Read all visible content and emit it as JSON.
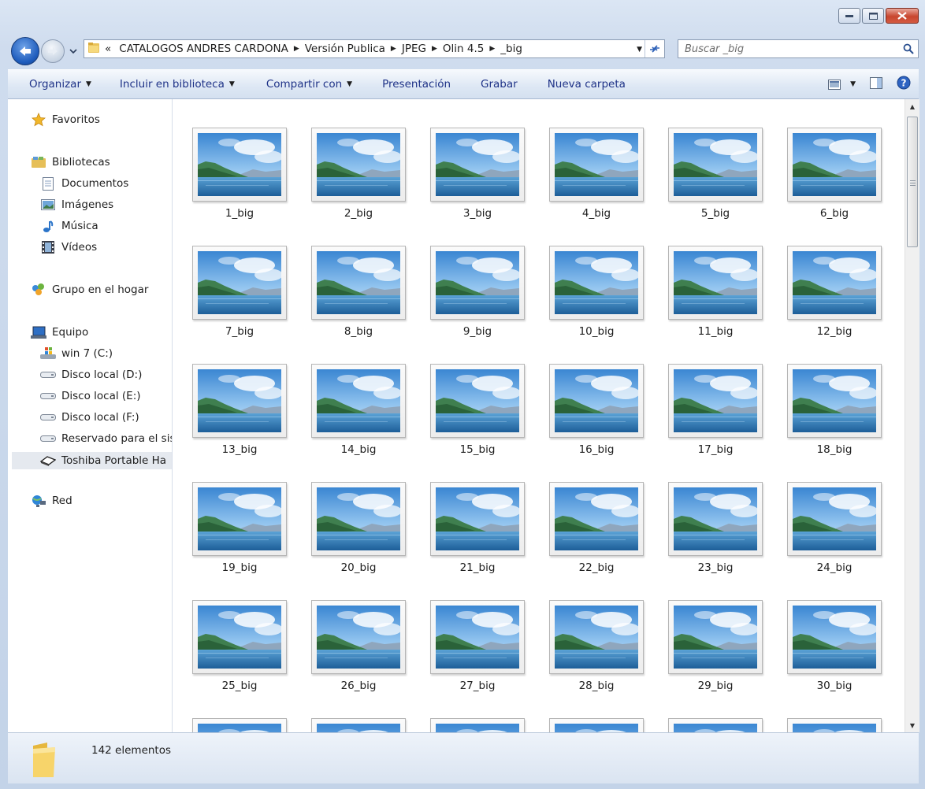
{
  "window": {
    "caption_buttons": [
      "minimize",
      "maximize",
      "close"
    ]
  },
  "address_bar": {
    "overflow": "«",
    "crumbs": [
      "CATALOGOS ANDRES CARDONA",
      "Versión Publica",
      "JPEG",
      "Olin 4.5",
      "_big"
    ]
  },
  "search": {
    "placeholder": "Buscar _big"
  },
  "toolbar": {
    "organize": "Organizar",
    "include_library": "Incluir en biblioteca",
    "share_with": "Compartir con",
    "slideshow": "Presentación",
    "burn": "Grabar",
    "new_folder": "Nueva carpeta"
  },
  "nav": {
    "favorites": "Favoritos",
    "libraries": "Bibliotecas",
    "documents": "Documentos",
    "pictures": "Imágenes",
    "music": "Música",
    "videos": "Vídeos",
    "homegroup": "Grupo en el hogar",
    "computer": "Equipo",
    "drive_c": "win 7 (C:)",
    "drive_d": "Disco local (D:)",
    "drive_e": "Disco local (E:)",
    "drive_f": "Disco local (F:)",
    "reserved": "Reservado para el sis",
    "toshiba": "Toshiba Portable Ha",
    "network": "Red"
  },
  "files": [
    "1_big",
    "2_big",
    "3_big",
    "4_big",
    "5_big",
    "6_big",
    "7_big",
    "8_big",
    "9_big",
    "10_big",
    "11_big",
    "12_big",
    "13_big",
    "14_big",
    "15_big",
    "16_big",
    "17_big",
    "18_big",
    "19_big",
    "20_big",
    "21_big",
    "22_big",
    "23_big",
    "24_big",
    "25_big",
    "26_big",
    "27_big",
    "28_big",
    "29_big",
    "30_big",
    "",
    "",
    "",
    "",
    "",
    ""
  ],
  "status": {
    "item_count": "142 elementos"
  },
  "colors": {
    "toolbar_text": "#1e3287",
    "close_red": "#c8462f",
    "accent_blue": "#1f5dbd"
  }
}
